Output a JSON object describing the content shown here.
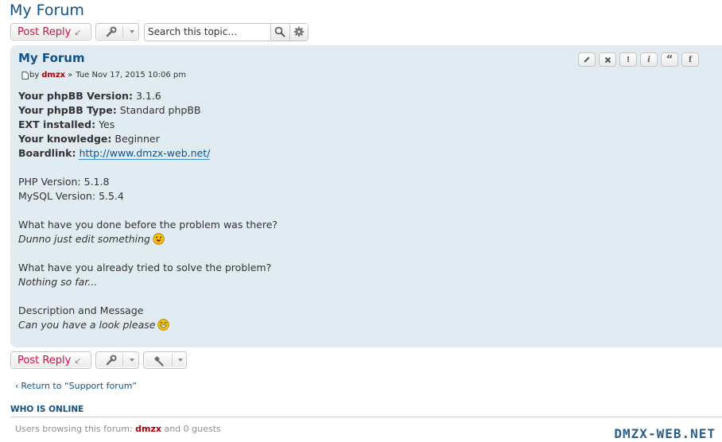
{
  "page": {
    "title": "My Forum"
  },
  "toolbar": {
    "post_reply_label": "Post Reply",
    "search_placeholder": "Search this topic…"
  },
  "post": {
    "title": "My Forum",
    "by_label": "by",
    "author": "dmzx",
    "separator": "»",
    "date": "Tue Nov 17, 2015 10:06 pm",
    "action_labels": {
      "warn": "!",
      "info": "i",
      "quote": "“",
      "share": "f"
    },
    "fields": {
      "version_label": "Your phpBB Version:",
      "version_value": "3.1.6",
      "type_label": "Your phpBB Type:",
      "type_value": "Standard phpBB",
      "ext_label": "EXT installed:",
      "ext_value": "Yes",
      "knowledge_label": "Your knowledge:",
      "knowledge_value": "Beginner",
      "boardlink_label": "Boardlink:",
      "boardlink_value": "http://www.dmzx-web.net/",
      "php_label": "PHP Version:",
      "php_value": "5.1.8",
      "mysql_label": "MySQL Version:",
      "mysql_value": "5.5.4",
      "q1": "What have you done before the problem was there?",
      "a1": "Dunno just edit something",
      "q2": "What have you already tried to solve the problem?",
      "a2": "Nothing so far...",
      "q3": "Description and Message",
      "a3": "Can you have a look please"
    }
  },
  "footer": {
    "return_label": "Return to “Support forum”",
    "who_online_heading": "WHO IS ONLINE",
    "browsing_prefix": "Users browsing this forum:",
    "browsing_user": "dmzx",
    "browsing_suffix": "and 0 guests",
    "watermark": "DMZX-WEB.NET"
  },
  "colors": {
    "post_bg": "#e1ebf2",
    "link": "#105289",
    "author": "#aa0000",
    "reply_text": "#d31141"
  }
}
